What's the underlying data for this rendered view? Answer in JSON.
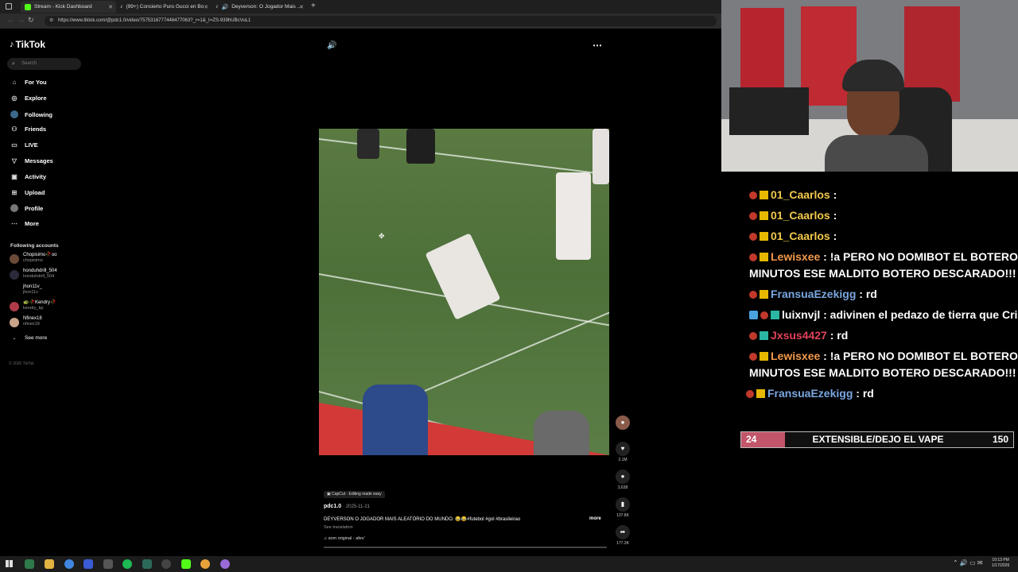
{
  "browser": {
    "tabs": [
      {
        "title": "Stream - Kick Dashboard",
        "color": "#53fc18"
      },
      {
        "title": "(99+) Concierto Puro Gucci en Bo",
        "color": "#fff"
      },
      {
        "title": "Deyverson: O Jogador Mais ...",
        "color": "#fff"
      }
    ],
    "url": "https://www.tiktok.com/@pdc1.0/video/7575316777446477063?_r=1&_t=ZS-939hUBcVuL1"
  },
  "tiktok": {
    "logo": "TikTok",
    "search_placeholder": "Search",
    "nav": [
      {
        "label": "For You",
        "icon": "home-icon"
      },
      {
        "label": "Explore",
        "icon": "compass-icon"
      },
      {
        "label": "Following",
        "icon": "following-icon"
      },
      {
        "label": "Friends",
        "icon": "friends-icon"
      },
      {
        "label": "LIVE",
        "icon": "live-icon"
      },
      {
        "label": "Messages",
        "icon": "messages-icon"
      },
      {
        "label": "Activity",
        "icon": "activity-icon"
      },
      {
        "label": "Upload",
        "icon": "upload-icon"
      },
      {
        "label": "Profile",
        "icon": "profile-icon"
      },
      {
        "label": "More",
        "icon": "more-icon"
      }
    ],
    "following_title": "Following accounts",
    "accounts": [
      {
        "name": "Chopisimo🥀oo",
        "handle": "chopisimo"
      },
      {
        "name": "honduhdrill_504",
        "handle": "honduhdrill_504"
      },
      {
        "name": "jhon11v_",
        "handle": "jhon11v"
      },
      {
        "name": "🐢🥀Kendry🥀",
        "handle": "kendry_kp"
      },
      {
        "name": "Nfinex18",
        "handle": "nfinex18"
      }
    ],
    "see_more": "See more",
    "copyright": "© 2026 TikTok",
    "video": {
      "capcut": "CapCut · Editing made easy",
      "author": "pdc1.0",
      "date": "2025-11-21",
      "caption": "DEYVERSON O JOGADOR MAIS ALEATÓRIO DO MUNDO. 😂😂#futebol #gol #brasileirao",
      "more": "more",
      "see_translation": "See translation",
      "sound": "som original - afex'",
      "likes": "2.1M",
      "comments": "3,638",
      "saves": "137.8K",
      "shares": "177.3K"
    }
  },
  "chat": {
    "messages": [
      {
        "user": "01_Caarlos",
        "user_color": "#f2c94c",
        "text": ":",
        "red_badge": true
      },
      {
        "user": "01_Caarlos",
        "user_color": "#f2c94c",
        "text": ":",
        "red_badge": true
      },
      {
        "user": "01_Caarlos",
        "user_color": "#f2c94c",
        "text": ":",
        "red_badge": true
      },
      {
        "user": "Lewisxee",
        "user_color": "#f2994a",
        "text": ": !a PERO NO DOMIBOT EL BOTERO MA",
        "red_badge": true
      },
      {
        "user": "",
        "user_color": "#fff",
        "text": "MINUTOS ESE MALDITO BOTERO DESCARADO!!!",
        "red_badge": false
      },
      {
        "user": "FransuaEzekigg",
        "user_color": "#7aa7e0",
        "text": ": rd",
        "red_badge": true
      },
      {
        "user": "luixnvjl",
        "user_color": "#fff",
        "text": ": adivinen el pedazo de tierra que Crist",
        "red_badge": true
      },
      {
        "user": "Jxsus4427",
        "user_color": "#e0425a",
        "text": ": rd",
        "red_badge": true
      },
      {
        "user": "Lewisxee",
        "user_color": "#f2994a",
        "text": ": !a PERO NO DOMIBOT EL BOTERO MA",
        "red_badge": true
      },
      {
        "user": "",
        "user_color": "#fff",
        "text": "MINUTOS ESE MALDITO BOTERO DESCARADO!!!",
        "red_badge": false
      },
      {
        "user": "FransuaEzekigg",
        "user_color": "#7aa7e0",
        "text": ": rd",
        "red_badge": true
      }
    ],
    "goal": {
      "current": "24",
      "label": "EXTENSIBLE/DEJO EL VAPE",
      "target": "150",
      "progress": 0.16
    }
  },
  "taskbar": {
    "time": "10:13 PM",
    "date": "1/17/2026"
  }
}
